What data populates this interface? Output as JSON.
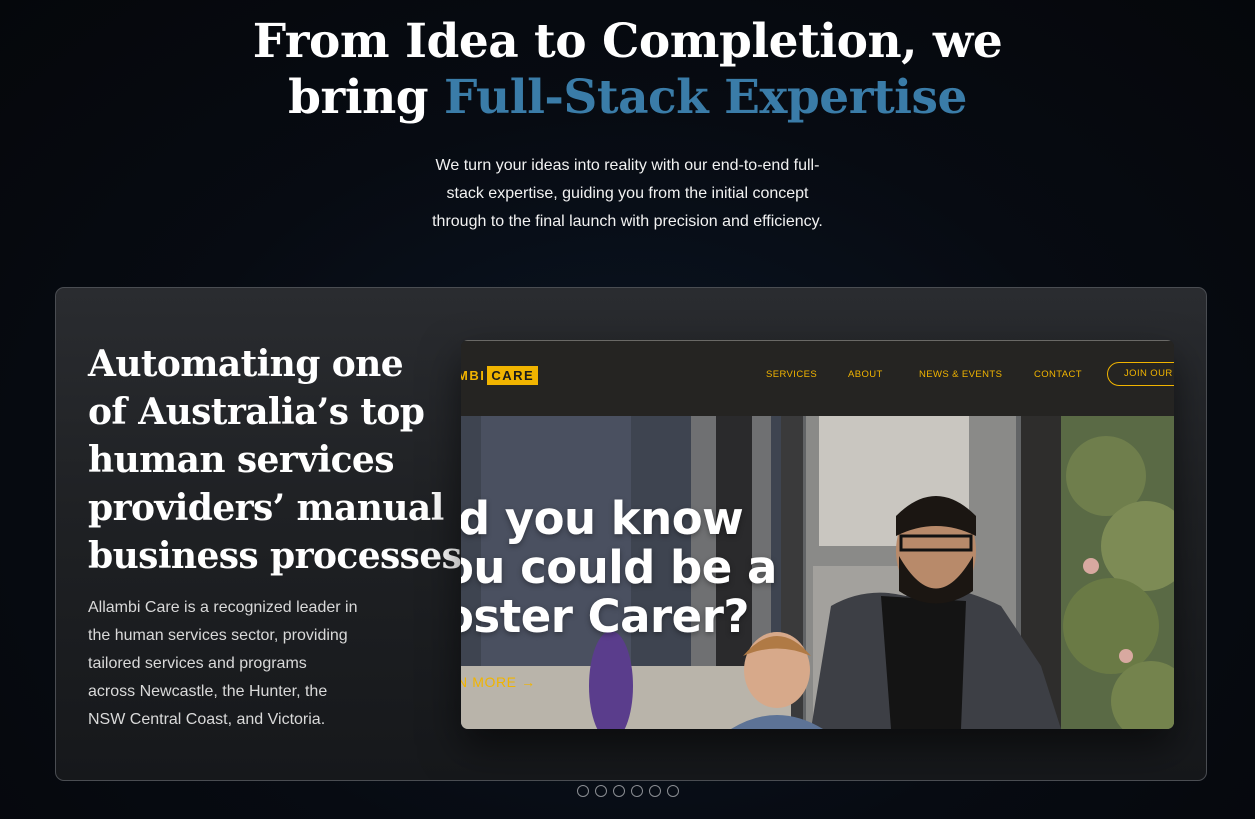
{
  "hero": {
    "title_line1": "From Idea to Completion, we",
    "title_line2_prefix": "bring ",
    "title_accent": "Full-Stack Expertise",
    "subtitle_lines": [
      "We turn your ideas into reality with our end-to-end full-",
      "stack expertise, guiding you from the initial concept",
      "through to the final launch with precision and efficiency."
    ]
  },
  "case_study": {
    "title_lines": [
      "Automating one",
      "of Australia’s top",
      "human services",
      "providers’ manual",
      "business processes"
    ],
    "description_lines": [
      "Allambi Care is a recognized leader in",
      "the human services sector, providing",
      "tailored services and programs",
      "across Newcastle, the Hunter, the",
      "NSW Central Coast, and Victoria."
    ],
    "screenshot": {
      "logo_left": "MBI",
      "logo_right": "CARE",
      "nav": [
        "SERVICES",
        "ABOUT",
        "NEWS & EVENTS",
        "CONTACT"
      ],
      "join_button": "JOIN OUR",
      "headline_lines": [
        "id you know",
        "ou could be a",
        "oster Carer?"
      ],
      "cta": "N MORE →"
    }
  },
  "carousel": {
    "dot_count": 6
  },
  "colors": {
    "accent_blue": "#3a7ca8",
    "brand_yellow": "#f1b400"
  }
}
